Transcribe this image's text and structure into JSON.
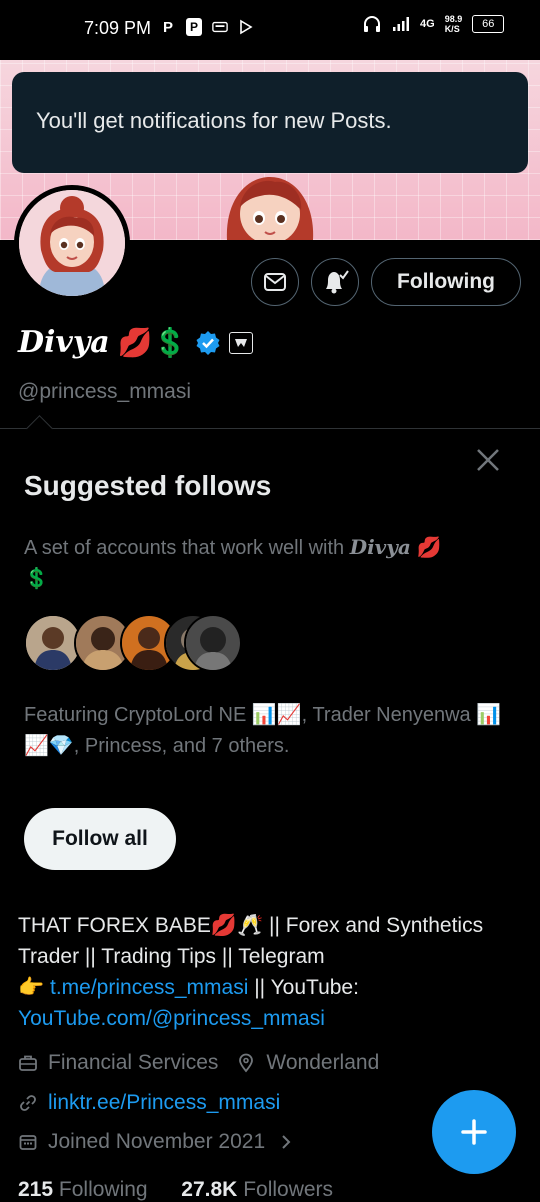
{
  "status_bar": {
    "time": "7:09 PM",
    "app_icons": [
      "P",
      "P",
      "app",
      "play"
    ],
    "network_type": "4G",
    "speed_value": "98.9",
    "speed_unit": "K/S",
    "battery_level": "66"
  },
  "toast": {
    "message": "You'll get notifications for new Posts."
  },
  "profile": {
    "display_name": "Divya",
    "name_emojis": "💋💲",
    "handle": "@princess_mmasi",
    "follow_button_label": "Following",
    "message_button_icon": "envelope-icon",
    "notify_button_icon": "bell-check-icon"
  },
  "suggested": {
    "title": "Suggested follows",
    "description_prefix": "A set of accounts that work well with",
    "description_name": "Divya",
    "description_emojis": "💋",
    "description_emoji2": "💲",
    "featuring": "Featuring CryptoLord NE 📊📈, Trader Nenyenwa 📊📈💎, Princess, and 7 others.",
    "follow_all_label": "Follow all"
  },
  "bio": {
    "line1": "THAT FOREX BABE💋🥂 || Forex and Synthetics Trader || Trading Tips || Telegram",
    "pointer": "👉",
    "telegram_link": "t.me/princess_mmasi",
    "mid": " || YouTube:",
    "youtube_link": "YouTube.com/@princess_mmasi"
  },
  "meta": {
    "category": "Financial Services",
    "location": "Wonderland",
    "website": "linktr.ee/Princess_mmasi",
    "joined": "Joined November 2021"
  },
  "counts": {
    "following_count": "215",
    "following_label": "Following",
    "followers_count": "27.8K",
    "followers_label": "Followers"
  },
  "colors": {
    "accent": "#1d9bf0",
    "toast_bg": "#0f1f2a",
    "muted": "#71767b"
  }
}
